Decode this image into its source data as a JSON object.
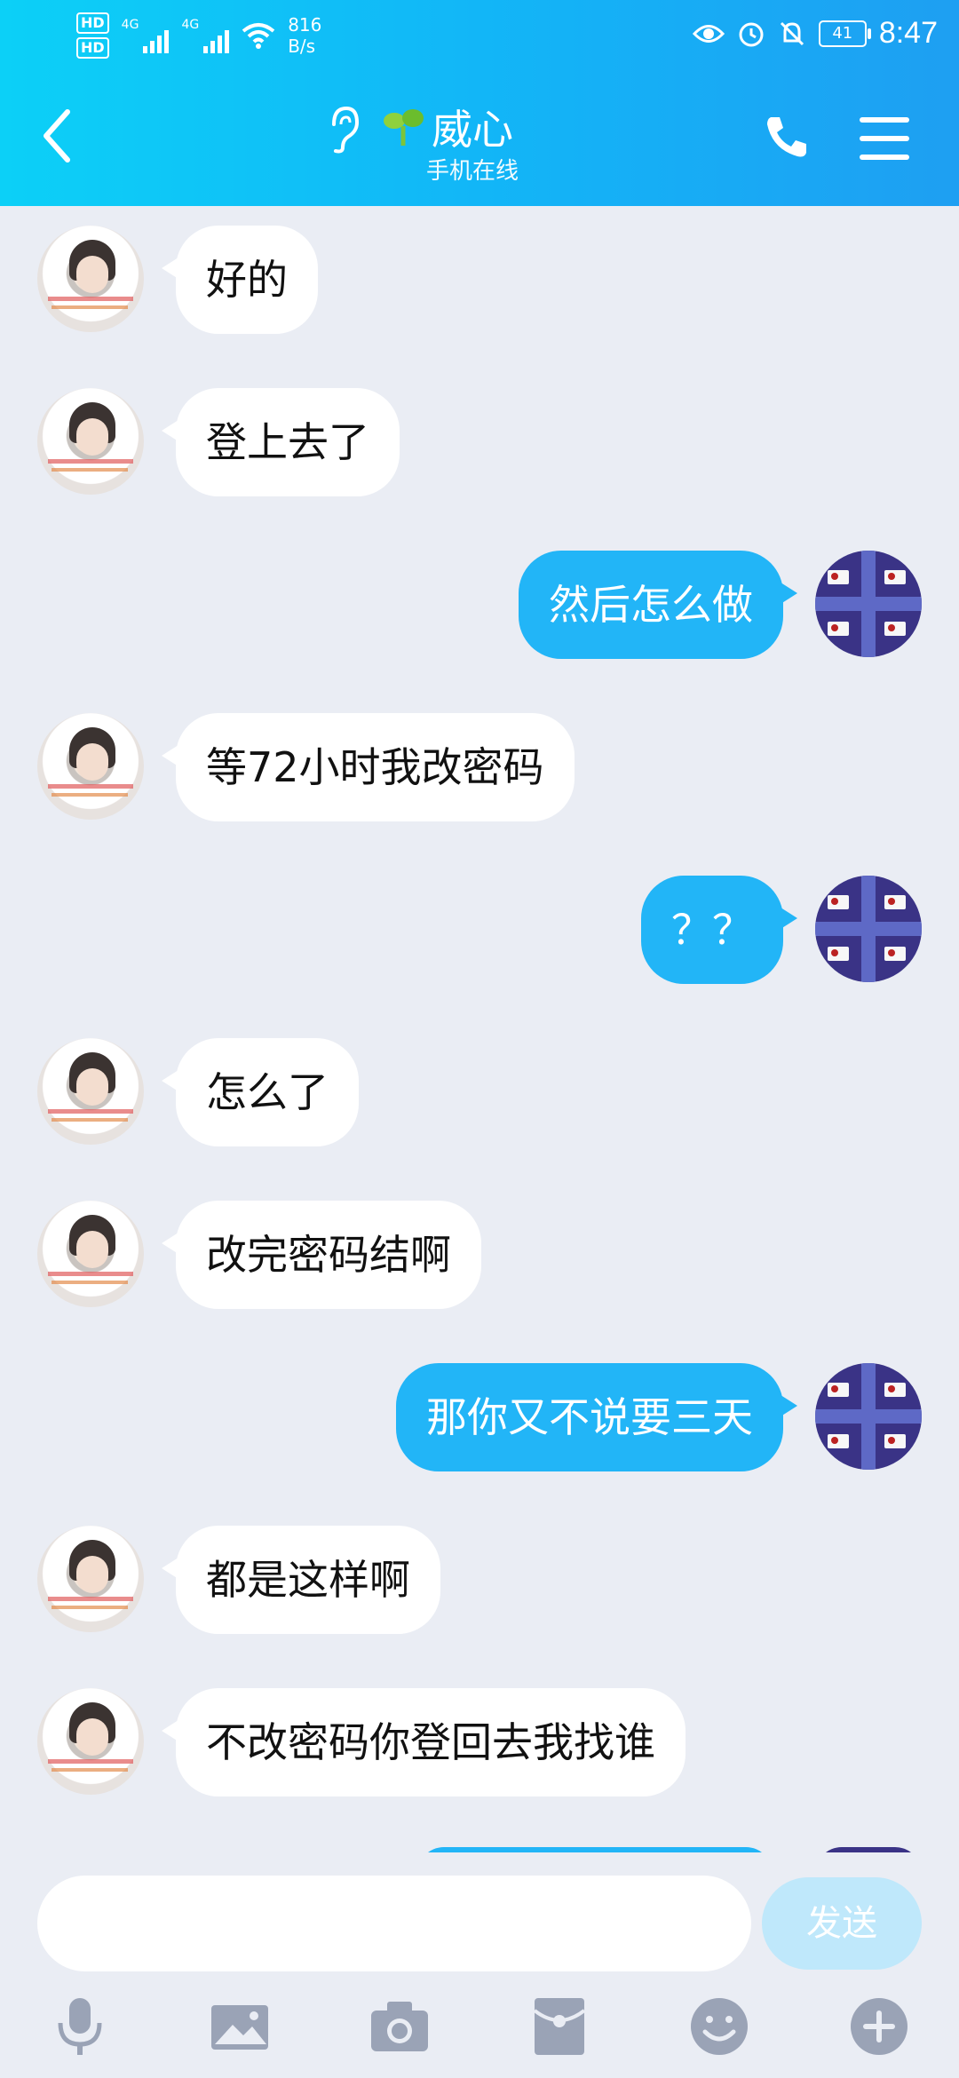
{
  "status_bar": {
    "network_type": "4G",
    "hd_labels": [
      "HD",
      "HD"
    ],
    "speed_value": "816",
    "speed_unit": "B/s",
    "battery": "41",
    "time": "8:47"
  },
  "header": {
    "back_icon": "chevron-left-icon",
    "ear_icon": "ear-icon",
    "sprout_icon": "sprout-icon",
    "title": "威心",
    "subtitle": "手机在线",
    "phone_icon": "phone-icon",
    "menu_icon": "menu-icon"
  },
  "messages": [
    {
      "side": "left",
      "text": "好的"
    },
    {
      "side": "left",
      "text": "登上去了"
    },
    {
      "side": "right",
      "text": "然后怎么做"
    },
    {
      "side": "left",
      "text": "等72小时我改密码"
    },
    {
      "side": "right",
      "text": "？？"
    },
    {
      "side": "left",
      "text": "怎么了"
    },
    {
      "side": "left",
      "text": "改完密码结啊"
    },
    {
      "side": "right",
      "text": "那你又不说要三天"
    },
    {
      "side": "left",
      "text": "都是这样啊"
    },
    {
      "side": "left",
      "text": "不改密码你登回去我找谁"
    }
  ],
  "input": {
    "value": "",
    "send_label": "发送"
  },
  "toolbar": {
    "icons": [
      "microphone-icon",
      "image-icon",
      "camera-icon",
      "red-packet-icon",
      "emoji-icon",
      "plus-icon"
    ]
  },
  "colors": {
    "header_start": "#0cd0f7",
    "header_end": "#1e9ff2",
    "bubble_sent": "#22b5f7",
    "bubble_received": "#ffffff",
    "chat_background": "#eaedf4",
    "send_button": "#bfe8fb",
    "toolbar_icon": "#9aa3b6"
  }
}
